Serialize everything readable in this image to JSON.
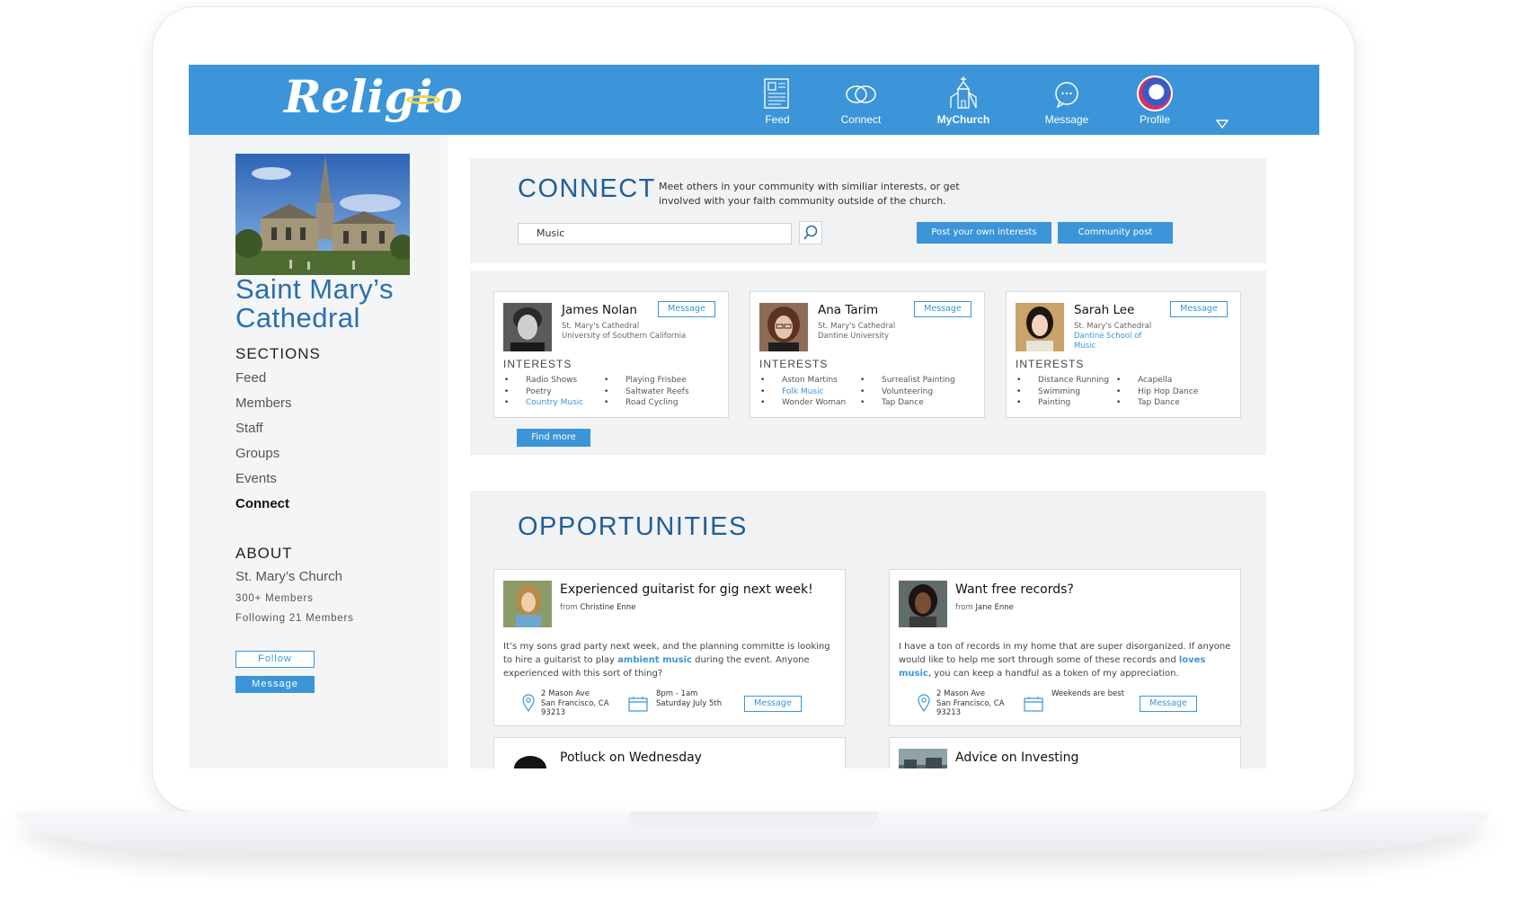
{
  "app": {
    "logo": "Religio"
  },
  "nav": {
    "items": [
      {
        "label": "Feed",
        "icon": "newspaper-icon"
      },
      {
        "label": "Connect",
        "icon": "rings-icon"
      },
      {
        "label": "MyChurch",
        "icon": "church-icon"
      },
      {
        "label": "Message",
        "icon": "chat-bubble-icon"
      },
      {
        "label": "Profile",
        "icon": "avatar"
      }
    ],
    "active": "MyChurch"
  },
  "sidebar": {
    "church_name": "Saint Mary’s Cathedral",
    "sections_heading": "SECTIONS",
    "sections": [
      "Feed",
      "Members",
      "Staff",
      "Groups",
      "Events",
      "Connect"
    ],
    "active_section": "Connect",
    "about_heading": "ABOUT",
    "about_name": "St. Mary’s Church",
    "members": "300+ Members",
    "following": "Following 21 Members",
    "follow_label": "Follow",
    "message_label": "Message"
  },
  "connect": {
    "title": "CONNECT",
    "description": "Meet others in your community with similiar interests, or get involved with your faith community outside of the church.",
    "search_value": "Music",
    "post_interests_label": "Post your own interests",
    "community_post_label": "Community post",
    "find_more_label": "Find more",
    "interests_heading": "INTERESTS",
    "message_label": "Message",
    "people": [
      {
        "name": "James Nolan",
        "church": "St. Mary's Cathedral",
        "school": "University of Southern California",
        "interests_left": [
          "Radio Shows",
          "Poetry",
          "Country Music"
        ],
        "interests_right": [
          "Playing Frisbee",
          "Saltwater Reefs",
          "Road Cycling"
        ]
      },
      {
        "name": "Ana Tarim",
        "church": "St. Mary's Cathedral",
        "school": "Dantine University",
        "interests_left": [
          "Aston Martins",
          "Folk Music",
          "Wonder Woman"
        ],
        "interests_right": [
          "Surrealist Painting",
          "Volunteering",
          "Tap Dance"
        ]
      },
      {
        "name": "Sarah Lee",
        "church": "St. Mary's Cathedral",
        "school": "Dantine School of Music",
        "interests_left": [
          "Distance Running",
          "Swimming",
          "Painting"
        ],
        "interests_right": [
          "Acapella",
          "Hip Hop Dance",
          "Tap Dance"
        ]
      }
    ]
  },
  "opportunities": {
    "title": "OPPORTUNITIES",
    "message_label": "Message",
    "from_prefix": "from",
    "posts": [
      {
        "title": "Experienced guitarist for gig next week!",
        "author": "Christine Enne",
        "body_1": "It’s my sons grad party next week, and the planning committe is looking to hire a guitarist to play ",
        "body_hl_1": "ambient music",
        "body_2": " during the event. Anyone experienced with this sort of thing?",
        "address_1": "2 Mason Ave",
        "address_2": "San Francisco, CA",
        "address_3": "93213",
        "time_1": "8pm - 1am",
        "time_2": "Saturday July 5th"
      },
      {
        "title": "Want free records?",
        "author": "Jane Enne",
        "body_1": "I have a ton of records in my home that are super disorganized. If anyone would like to help me sort through some of these records and ",
        "body_hl_1": "loves music",
        "body_2": ", you can keep a handful as a token of my appreciation.",
        "address_1": "2 Mason Ave",
        "address_2": "San Francisco, CA",
        "address_3": "93213",
        "time_1": "Weekends are best",
        "time_2": ""
      },
      {
        "title": "Potluck on Wednesday"
      },
      {
        "title": "Advice on Investing"
      }
    ]
  },
  "colors": {
    "brand_blue": "#3b95d8",
    "heading_blue": "#1f5f99",
    "panel_gray": "#f1f2f4",
    "sidebar_gray": "#f4f5f7"
  }
}
